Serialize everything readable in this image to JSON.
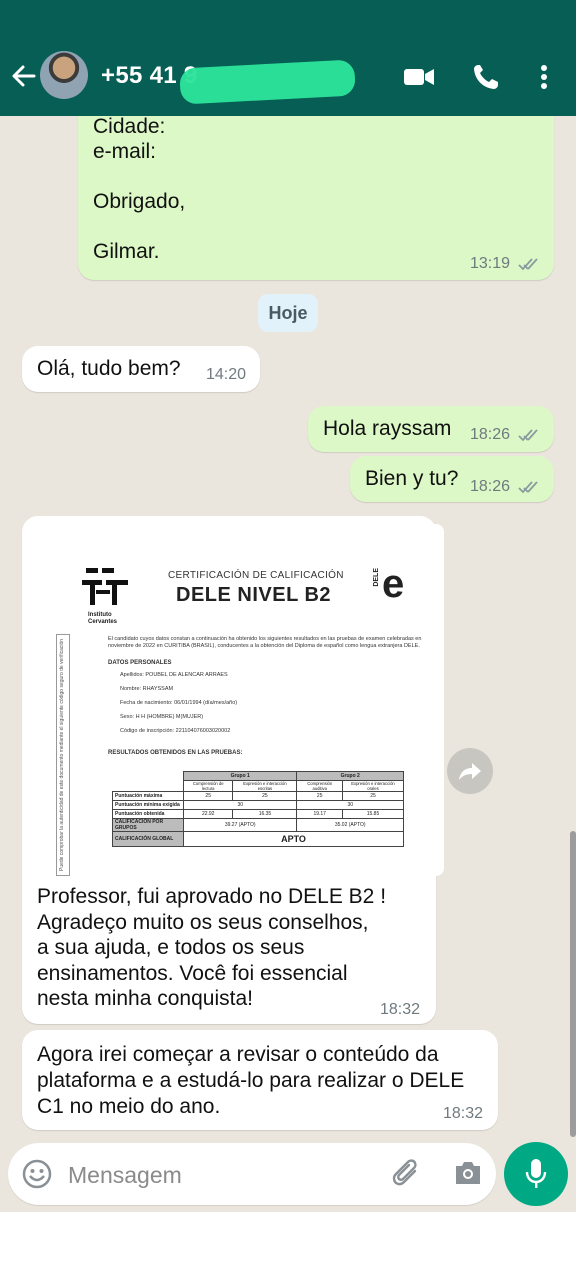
{
  "header": {
    "contact_name": "+55 41 9"
  },
  "date_chip": "Hoje",
  "messages": [
    {
      "lines": "Cidade:\ne-mail:\n\nObrigado,\n\nGilmar.",
      "time": "13:19",
      "direction": "out",
      "status": "read"
    },
    {
      "text": "Olá, tudo bem?",
      "time": "14:20",
      "direction": "in"
    },
    {
      "text": "Hola rayssam",
      "time": "18:26",
      "direction": "out",
      "status": "read"
    },
    {
      "text": "Bien y tu?",
      "time": "18:26",
      "direction": "out",
      "status": "read"
    },
    {
      "caption": "Professor, fui aprovado no DELE B2 !\nAgradeço muito os seus conselhos,\na sua ajuda, e todos os seus\nensinamentos. Você foi essencial\nnesta minha conquista!",
      "time": "18:32",
      "direction": "in"
    },
    {
      "text": "Agora irei começar a revisar o conteúdo da\nplataforma e a estudá-lo para realizar o DELE\nC1 no meio do ano.",
      "time": "18:32",
      "direction": "in"
    }
  ],
  "certificate": {
    "institute": "Instituto\nCervantes",
    "title_small": "CERTIFICACIÓN DE CALIFICACIÓN",
    "title_big": "DELE NIVEL B2",
    "brand_letter": "e",
    "brand_mark": "DELE",
    "side_text": "Puede comprobar la autenticidad de este documento mediante el siguiente código seguro de verificación",
    "intro": "El candidato cuyos datos constan a continuación ha obtenido los siguientes resultados en las pruebas de examen celebradas en noviembre de 2022 en CURITIBA (BRASIL), conducentes a la obtención del Diploma de español como lengua extranjera DELE.",
    "personal_heading": "DATOS PERSONALES",
    "surname": "Apellidos: POUBEL DE ALENCAR ARRAES",
    "name": "Nombre: RHAYSSAM",
    "birth": "Fecha de nacimiento: 06/01/1994 (día/mes/año)",
    "sex": "Sexo: H          H (HOMBRE)  M(MUJER)",
    "code": "Código de inscripción: 221104076003020002",
    "results_heading": "RESULTADOS OBTENIDOS EN LAS PRUEBAS:",
    "table": {
      "group1": "Grupo 1",
      "group2": "Grupo 2",
      "sub": [
        "Comprensión de lectura",
        "Expresión e interacción escritas",
        "Comprensión auditiva",
        "Expresión e interacción orales"
      ],
      "rows": [
        {
          "label": "Puntuación máxima",
          "values": [
            "25",
            "25",
            "25",
            "25"
          ]
        },
        {
          "label": "Puntuación mínima exigida",
          "values": [
            "30",
            "30"
          ]
        },
        {
          "label": "Puntuación obtenida",
          "values": [
            "22.92",
            "16.35",
            "19.17",
            "15.85"
          ]
        },
        {
          "label": "CALIFICACIÓN POR GRUPOS",
          "values": [
            "39.27 (APTO)",
            "35.02 (APTO)"
          ]
        },
        {
          "label": "CALIFICACIÓN GLOBAL",
          "values": [
            "APTO"
          ]
        }
      ]
    }
  },
  "composer": {
    "placeholder": "Mensagem"
  },
  "colors": {
    "header": "#075e54",
    "outgoing_bubble": "#dcf8c6",
    "incoming_bubble": "#ffffff",
    "send_button": "#00a884",
    "name_redaction": "#2de39b"
  }
}
